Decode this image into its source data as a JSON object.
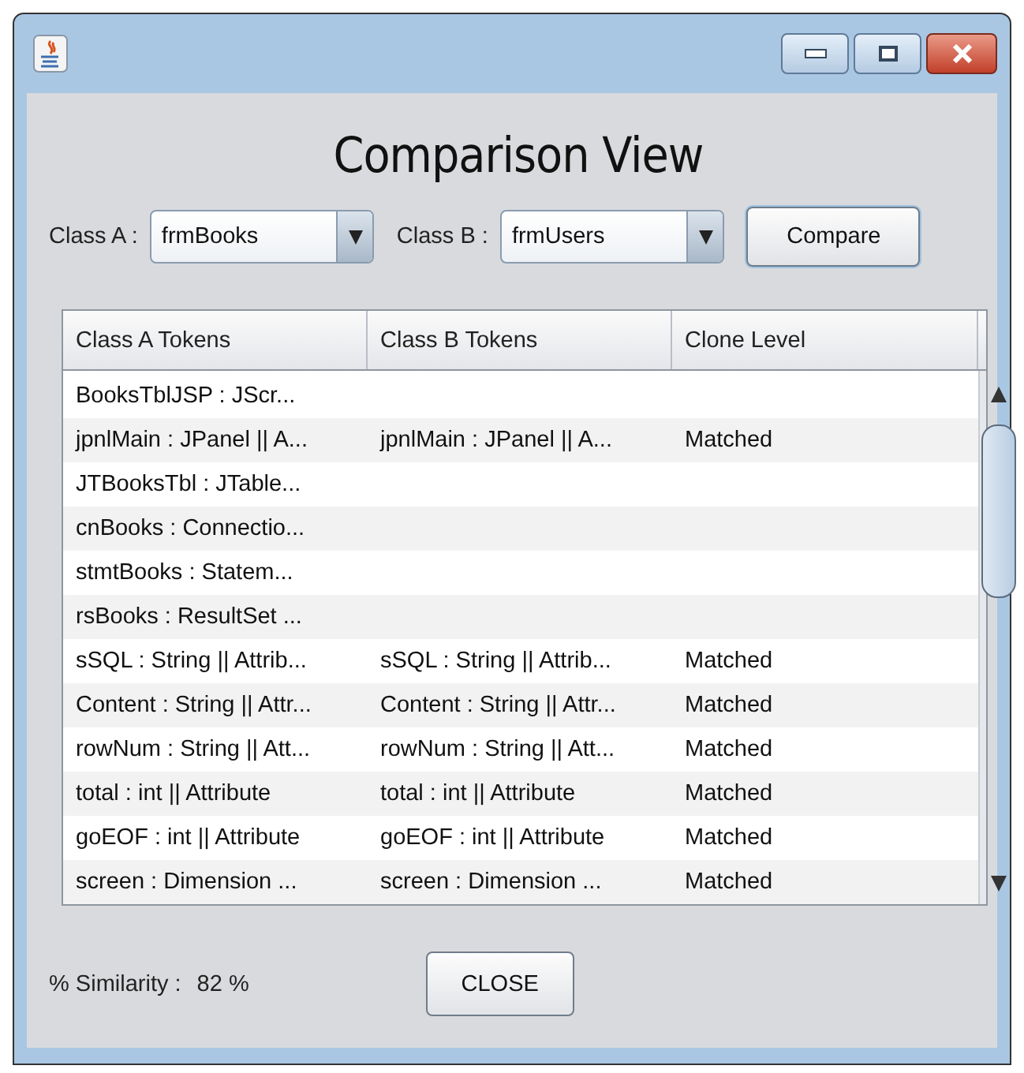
{
  "heading": "Comparison View",
  "selectors": [
    {
      "label": "Class A :",
      "value": "frmBooks"
    },
    {
      "label": "Class B :",
      "value": "frmUsers"
    }
  ],
  "compare_button": "Compare",
  "table": {
    "columns": [
      "Class A Tokens",
      "Class B Tokens",
      "Clone Level"
    ],
    "rows": [
      {
        "class_a": "BooksTblJSP : JScr..."
      },
      {
        "class_a": "jpnlMain : JPanel || A...",
        "class_b": "jpnlMain : JPanel || A...",
        "clone_level": "Matched"
      },
      {
        "class_a": "JTBooksTbl : JTable..."
      },
      {
        "class_a": "cnBooks : Connectio..."
      },
      {
        "class_a": "stmtBooks : Statem..."
      },
      {
        "class_a": "rsBooks : ResultSet ..."
      },
      {
        "class_a": "sSQL : String || Attrib...",
        "class_b": "sSQL : String || Attrib...",
        "clone_level": "Matched"
      },
      {
        "class_a": "Content : String || Attr...",
        "class_b": "Content : String || Attr...",
        "clone_level": "Matched"
      },
      {
        "class_a": "rowNum : String || Att...",
        "class_b": "rowNum : String || Att...",
        "clone_level": "Matched"
      },
      {
        "class_a": "total : int || Attribute",
        "class_b": "total : int || Attribute",
        "clone_level": "Matched"
      },
      {
        "class_a": "goEOF : int || Attribute",
        "class_b": "goEOF : int || Attribute",
        "clone_level": "Matched"
      },
      {
        "class_a": "screen : Dimension ...",
        "class_b": "screen : Dimension ...",
        "clone_level": "Matched"
      }
    ]
  },
  "similarity": {
    "label": "% Similarity :",
    "value": "82 %"
  },
  "close_button": "CLOSE"
}
